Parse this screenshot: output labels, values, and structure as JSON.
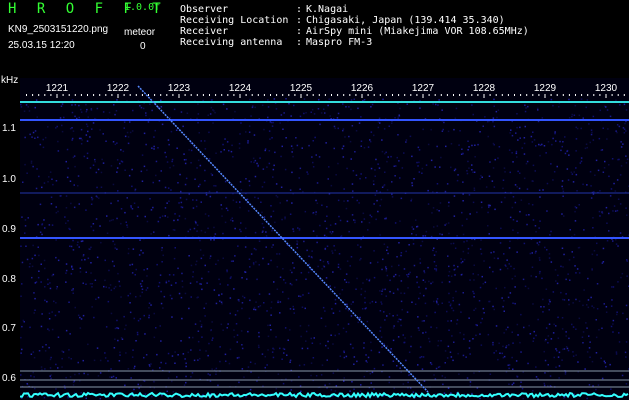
{
  "header": {
    "app_title": "H R O F F T",
    "version": "1.0.0f",
    "filename": "KN9_2503151220.png",
    "date": "25.03.15 12:20",
    "meteor_label": "meteor",
    "meteor_count": "0"
  },
  "info": {
    "observer_label": "Observer",
    "observer_value": "K.Nagai",
    "location_label": "Receiving Location",
    "location_value": "Chigasaki, Japan (139.414 35.340)",
    "receiver_label": "Receiver",
    "receiver_value": "AirSpy mini (Miakejima VOR 108.65MHz)",
    "antenna_label": "Receiving antenna",
    "antenna_value": "Maspro FM-3",
    "separator": ":"
  },
  "axes": {
    "y_unit": "kHz",
    "x_ticks": [
      "1221",
      "1222",
      "1223",
      "1224",
      "1225",
      "1226",
      "1227",
      "1228",
      "1229",
      "1230"
    ],
    "y_ticks": [
      "1.1",
      "1.0",
      "0.9",
      "0.8",
      "0.7",
      "0.6"
    ]
  },
  "colors": {
    "background": "#000000",
    "noise_floor": "#0a0a3a",
    "carrier_line": "#3355ff",
    "trace": "#66aaff",
    "baseline": "#33ffff",
    "text": "#ffffff",
    "title_green": "#33ff33"
  }
}
